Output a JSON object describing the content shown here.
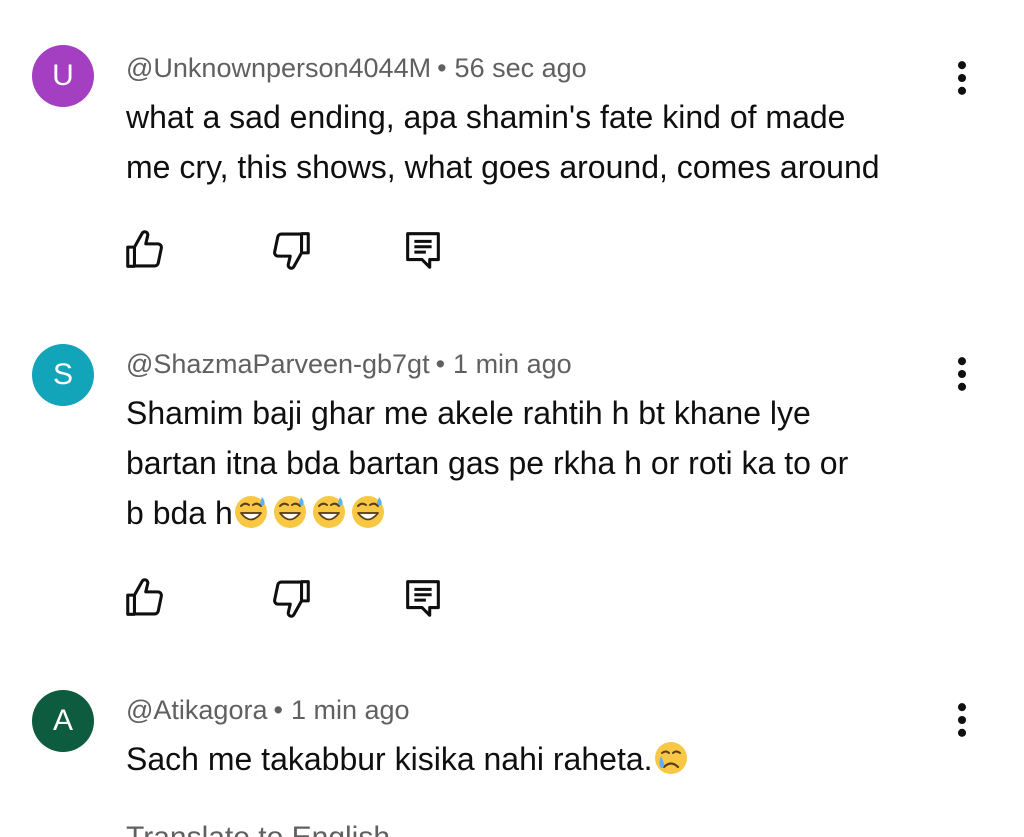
{
  "comments": [
    {
      "avatar_letter": "U",
      "avatar_color": "#a43fc1",
      "handle": "@Unknownperson4044M",
      "separator": "•",
      "time": "56 sec ago",
      "text_line1": "what a sad ending, apa shamin's fate kind of made",
      "text_line2": "me cry, this shows, what goes around, comes around",
      "icons": [
        "like-icon",
        "dislike-icon",
        "reply-icon",
        "more-vert-icon"
      ]
    },
    {
      "avatar_letter": "S",
      "avatar_color": "#12a4b8",
      "handle": "@ShazmaParveen-gb7gt",
      "separator": "•",
      "time": "1 min ago",
      "text_line1": "Shamim baji ghar me akele rahtih h bt khane  lye",
      "text_line2": "bartan  itna bda bartan gas pe rkha h or roti ka to or",
      "text_line3": "b bda h",
      "emoji": [
        "grinning-sweat-emoji",
        "grinning-sweat-emoji",
        "grinning-sweat-emoji",
        "grinning-sweat-emoji"
      ],
      "icons": [
        "like-icon",
        "dislike-icon",
        "reply-icon",
        "more-vert-icon"
      ]
    },
    {
      "avatar_letter": "A",
      "avatar_color": "#0d5c3f",
      "handle": "@Atikagora",
      "separator": "•",
      "time": "1 min ago",
      "text_line1": "Sach me takabbur kisika nahi raheta.",
      "emoji": [
        "crying-face-emoji"
      ],
      "icons": [
        "more-vert-icon"
      ]
    }
  ],
  "translate_label": "Translate to English"
}
